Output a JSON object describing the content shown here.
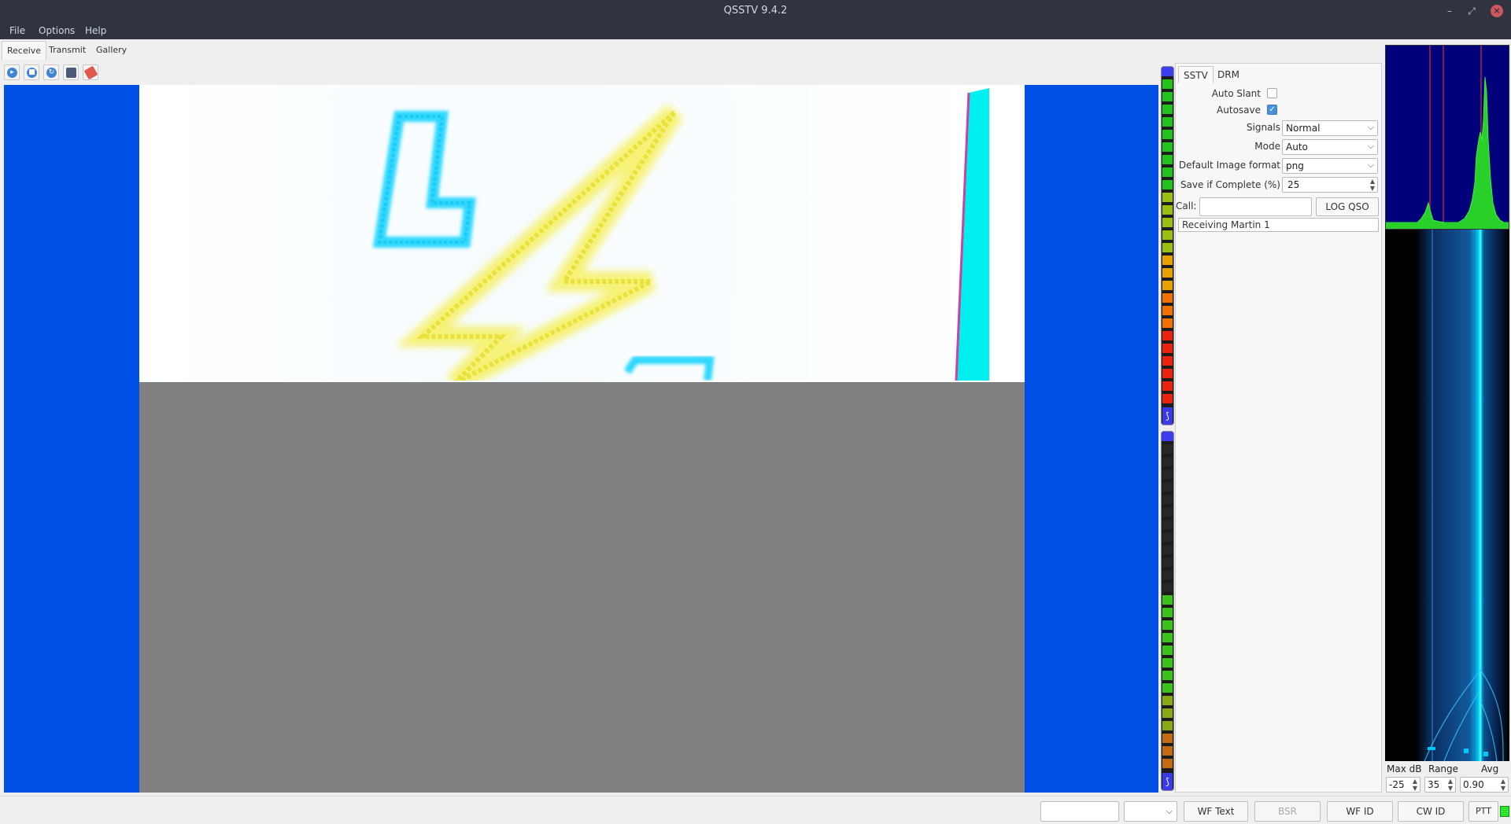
{
  "window": {
    "title": "QSSTV 9.4.2"
  },
  "menu": {
    "file": "File",
    "options": "Options",
    "help": "Help"
  },
  "tabs": {
    "receive": "Receive",
    "transmit": "Transmit",
    "gallery": "Gallery"
  },
  "toolbar_icons": [
    "start-icon",
    "stop-icon",
    "resync-icon",
    "save-icon",
    "erase-icon"
  ],
  "image": {
    "progress_percent": 42,
    "colors": {
      "side": "#0050e6",
      "pending": "#808080"
    }
  },
  "panel": {
    "tabs": {
      "sstv": "SSTV",
      "drm": "DRM"
    },
    "auto_slant_label": "Auto Slant",
    "auto_slant": false,
    "autosave_label": "Autosave",
    "autosave": true,
    "signals_label": "Signals",
    "signals_value": "Normal",
    "mode_label": "Mode",
    "mode_value": "Auto",
    "image_format_label": "Default Image format",
    "image_format_value": "png",
    "save_complete_label": "Save if Complete (%)",
    "save_complete_value": "25",
    "call_label": "Call:",
    "call_value": "",
    "log_qso": "LOG QSO",
    "status": "Receiving Martin 1"
  },
  "waterfall": {
    "max_db_label": "Max dB",
    "range_label": "Range",
    "avg_label": "Avg",
    "max_db_value": "-25",
    "range_value": "35",
    "avg_value": "0.90"
  },
  "statusbar": {
    "wf_text": "WF Text",
    "bsr": "BSR",
    "wf_id": "WF ID",
    "cw_id": "CW ID",
    "ptt": "PTT"
  }
}
